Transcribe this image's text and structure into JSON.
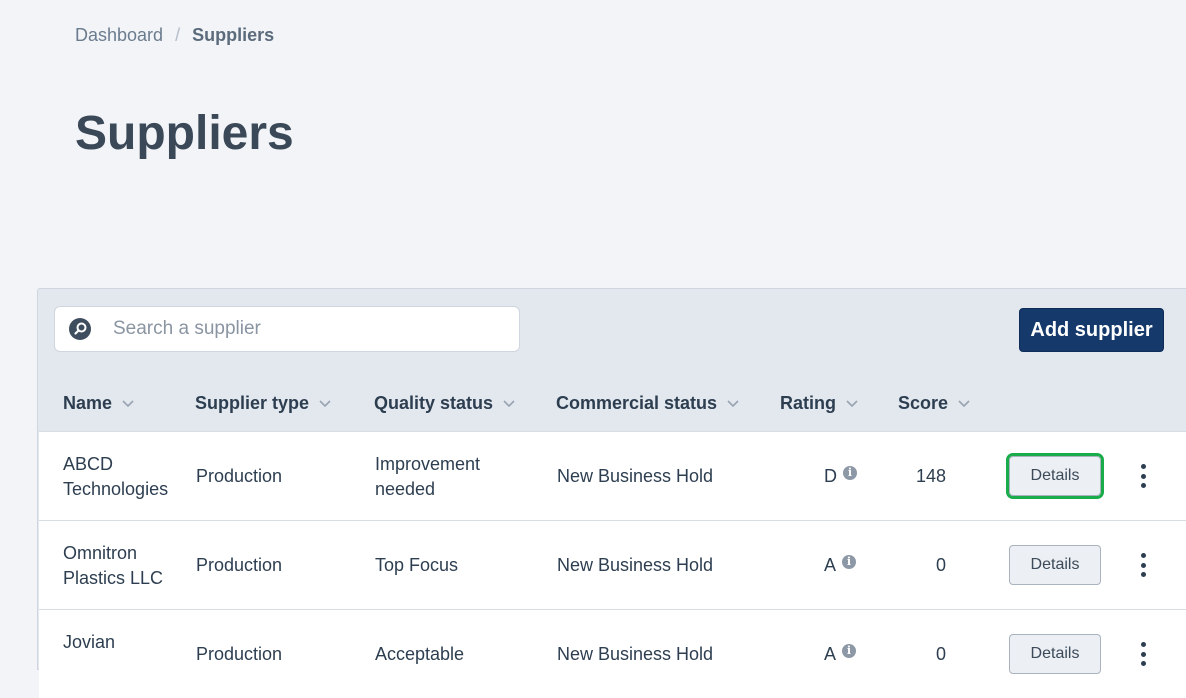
{
  "breadcrumb": {
    "root": "Dashboard",
    "separator": "/",
    "current": "Suppliers"
  },
  "page_title": "Suppliers",
  "toolbar": {
    "search_placeholder": "Search a supplier",
    "search_value": "",
    "add_label": "Add supplier"
  },
  "table": {
    "columns": [
      "Name",
      "Supplier type",
      "Quality status",
      "Commercial status",
      "Rating",
      "Score"
    ],
    "rows": [
      {
        "name_line1": "ABCD",
        "name_line2": "Technologies",
        "type": "Production",
        "quality_line1": "Improvement",
        "quality_line2": "needed",
        "commercial": "New Business Hold",
        "rating": "D",
        "score": "148",
        "action": "Details"
      },
      {
        "name_line1": "Omnitron",
        "name_line2": "Plastics LLC",
        "type": "Production",
        "quality_line1": "Top Focus",
        "quality_line2": "",
        "commercial": "New Business Hold",
        "rating": "A",
        "score": "0",
        "action": "Details"
      },
      {
        "name_line1": "Jovian",
        "name_line2": "",
        "type": "Production",
        "quality_line1": "Acceptable",
        "quality_line2": "",
        "commercial": "New Business Hold",
        "rating": "A",
        "score": "0",
        "action": "Details"
      }
    ]
  },
  "colors": {
    "primary": "#15396b",
    "highlight": "#1aab4b",
    "background": "#f2f4f7"
  },
  "icons": {
    "search": "search-icon",
    "sort": "chevron-down-icon",
    "info": "info-icon",
    "more": "more-vertical-icon"
  }
}
